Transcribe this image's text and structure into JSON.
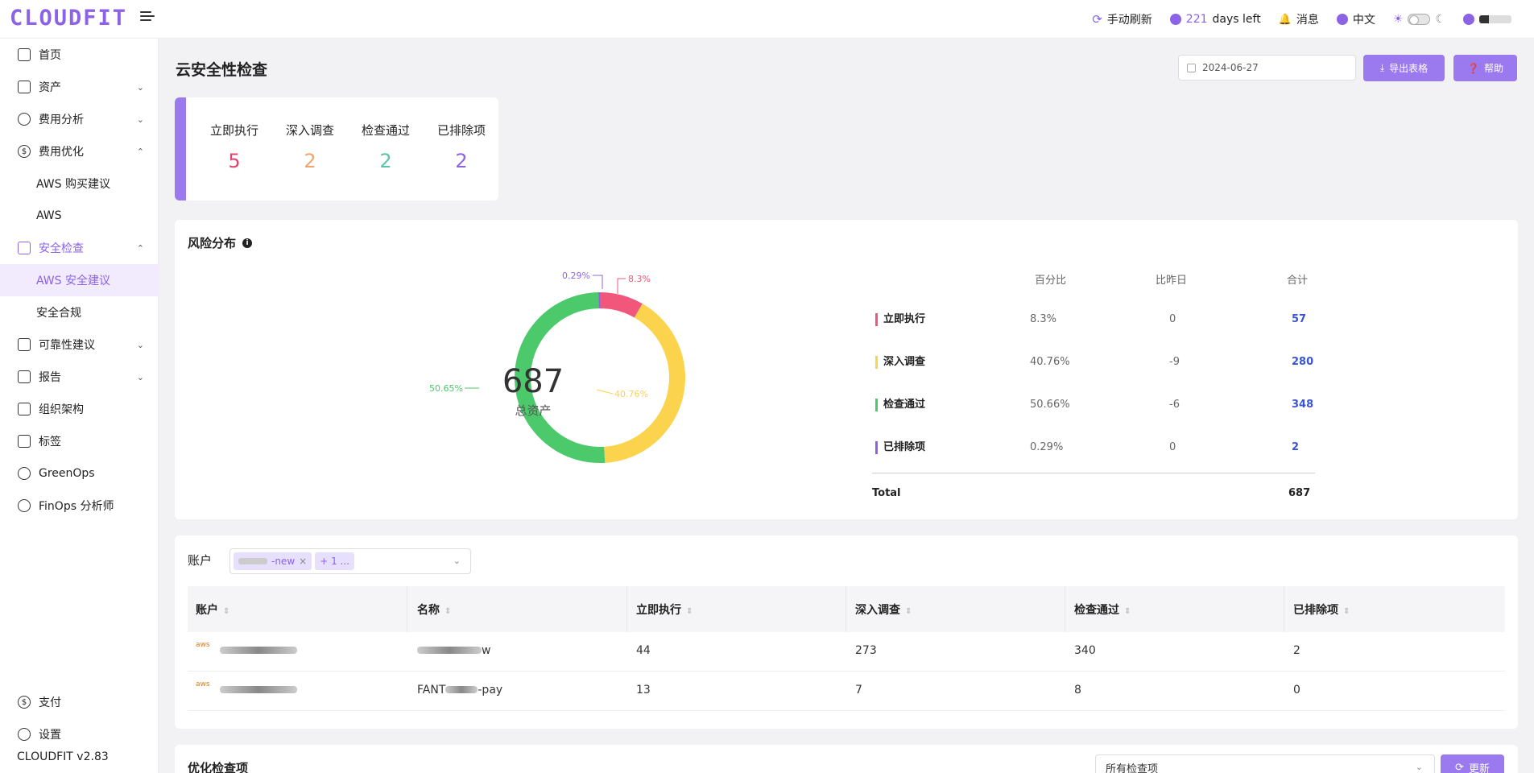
{
  "header": {
    "logo": "CLOUDFIT",
    "refresh": "手动刷新",
    "days_num": "221",
    "days_text": "days left",
    "messages": "消息",
    "language": "中文"
  },
  "sidebar": {
    "items": [
      {
        "label": "首页"
      },
      {
        "label": "资产"
      },
      {
        "label": "费用分析"
      },
      {
        "label": "费用优化"
      },
      {
        "label": "AWS 购买建议"
      },
      {
        "label": "AWS"
      },
      {
        "label": "安全检查"
      },
      {
        "label": "AWS 安全建议"
      },
      {
        "label": "安全合规"
      },
      {
        "label": "可靠性建议"
      },
      {
        "label": "报告"
      },
      {
        "label": "组织架构"
      },
      {
        "label": "标签"
      },
      {
        "label": "GreenOps"
      },
      {
        "label": "FinOps 分析师"
      }
    ],
    "bottom": [
      {
        "label": "支付"
      },
      {
        "label": "设置"
      }
    ],
    "version": "CLOUDFIT v2.83"
  },
  "page": {
    "title": "云安全性检查",
    "date": "2024-06-27",
    "export_label": "导出表格",
    "help_label": "帮助"
  },
  "stats": [
    {
      "label": "立即执行",
      "value": "5",
      "color": "#e0436b"
    },
    {
      "label": "深入调查",
      "value": "2",
      "color": "#f3a46b"
    },
    {
      "label": "检查通过",
      "value": "2",
      "color": "#55c7a6"
    },
    {
      "label": "已排除项",
      "value": "2",
      "color": "#8c63e6"
    }
  ],
  "risk": {
    "title": "风险分布",
    "center_value": "687",
    "center_label": "总资产",
    "columns": [
      "百分比",
      "比昨日",
      "合计"
    ],
    "rows": [
      {
        "name": "立即执行",
        "pct": "8.3%",
        "diff": "0",
        "total": "57",
        "color": "#f0577a"
      },
      {
        "name": "深入调查",
        "pct": "40.76%",
        "diff": "-9",
        "total": "280",
        "color": "#fcd34d"
      },
      {
        "name": "检查通过",
        "pct": "50.66%",
        "diff": "-6",
        "total": "348",
        "color": "#4bc96b"
      },
      {
        "name": "已排除项",
        "pct": "0.29%",
        "diff": "0",
        "total": "2",
        "color": "#8c63e6"
      }
    ],
    "total_label": "Total",
    "total_value": "687",
    "labels": {
      "red": "8.3%",
      "yellow": "40.76%",
      "green": "50.65%",
      "purple": "0.29%"
    }
  },
  "chart_data": {
    "type": "pie",
    "categories": [
      "立即执行",
      "深入调查",
      "检查通过",
      "已排除项"
    ],
    "values": [
      57,
      280,
      348,
      2
    ],
    "colors": [
      "#f0577a",
      "#fcd34d",
      "#4bc96b",
      "#8c63e6"
    ]
  },
  "accounts": {
    "label": "账户",
    "tag1_suffix": "-new",
    "tag2": "+ 1 ...",
    "columns": [
      "账户",
      "名称",
      "立即执行",
      "深入调查",
      "检查通过",
      "已排除项"
    ],
    "rows": [
      {
        "logo": "aws",
        "name_suffix": "w",
        "c1": "44",
        "c2": "273",
        "c3": "340",
        "c4": "2"
      },
      {
        "logo": "aws",
        "name_prefix": "FANT",
        "name_suffix": "-pay",
        "c1": "13",
        "c2": "7",
        "c3": "8",
        "c4": "0"
      }
    ]
  },
  "optimize": {
    "title": "优化检查项",
    "select_value": "所有检查项",
    "refresh_label": "更新"
  }
}
